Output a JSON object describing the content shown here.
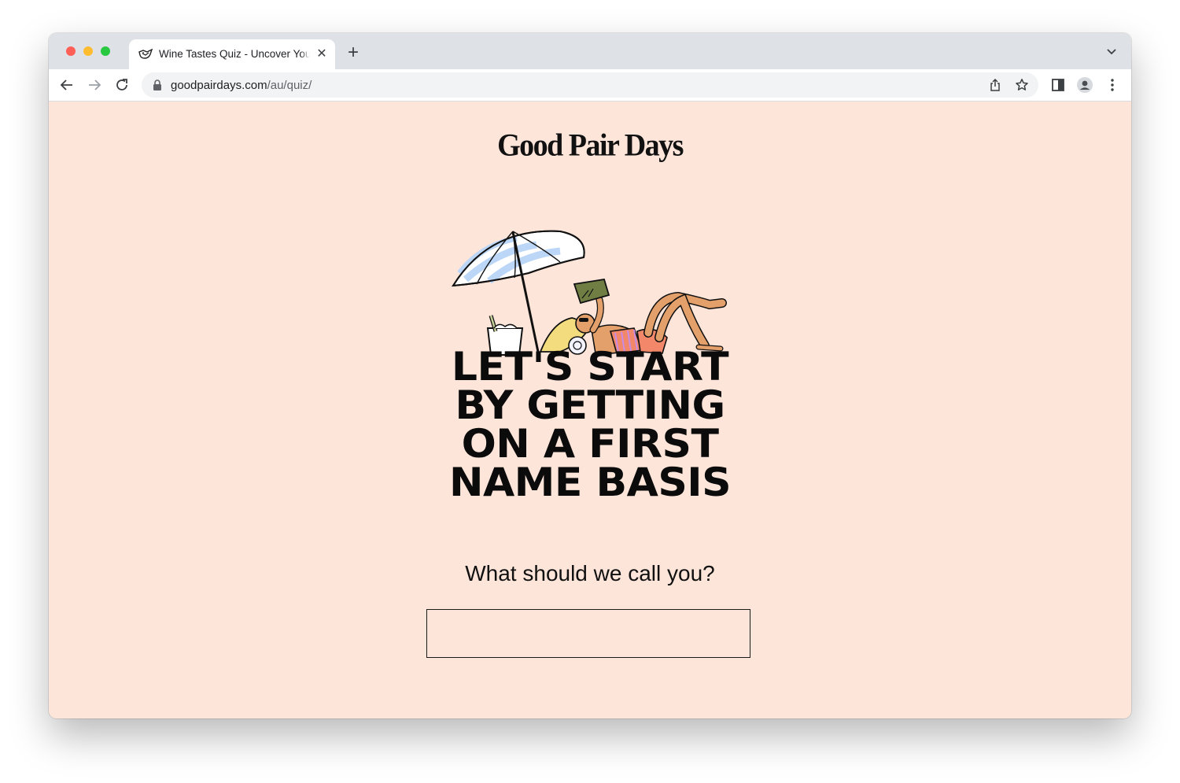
{
  "browser": {
    "tab": {
      "title": "Wine Tastes Quiz - Uncover Your Wine Preferences",
      "favicon": "wine-bird-icon"
    },
    "url": {
      "domain": "goodpairdays.com",
      "path": "/au/quiz/"
    },
    "icons": {
      "back": "back-arrow-icon",
      "forward": "forward-arrow-icon",
      "reload": "reload-icon",
      "share": "share-icon",
      "bookmark": "star-icon",
      "sidepanel": "side-panel-icon",
      "profile": "profile-avatar-icon",
      "menu": "kebab-menu-icon"
    }
  },
  "page": {
    "logo": "Good Pair Days",
    "headline_lines": [
      "LET'S START",
      "BY GETTING",
      "ON A FIRST",
      "NAME BASIS"
    ],
    "question": "What should we call you?",
    "name_input_value": ""
  },
  "colors": {
    "page_background": "#fde5da",
    "text": "#111111",
    "tabbar": "#dee1e6"
  }
}
